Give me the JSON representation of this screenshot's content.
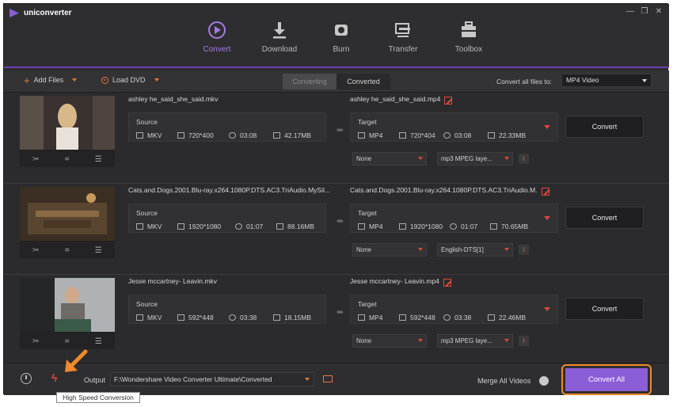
{
  "app": {
    "title": "uniconverter"
  },
  "window_controls": {
    "minimize": "—",
    "restore": "❐",
    "close": "✕"
  },
  "nav": [
    {
      "label": "Convert",
      "icon": "convert-icon",
      "active": true
    },
    {
      "label": "Download",
      "icon": "download-icon",
      "active": false
    },
    {
      "label": "Burn",
      "icon": "burn-icon",
      "active": false
    },
    {
      "label": "Transfer",
      "icon": "transfer-icon",
      "active": false
    },
    {
      "label": "Toolbox",
      "icon": "toolbox-icon",
      "active": false
    }
  ],
  "toolbar": {
    "add_files": "Add Files",
    "load_dvd": "Load DVD",
    "tab_converting": "Converting",
    "tab_converted": "Converted",
    "convert_all_to_label": "Convert all files to:",
    "convert_all_to_value": "MP4 Video"
  },
  "rows": [
    {
      "source_name": "ashley he_said_she_said.mkv",
      "source_label": "Source",
      "source": {
        "format": "MKV",
        "resolution": "720*400",
        "duration": "03:08",
        "size": "42.17MB"
      },
      "target_name": "ashley he_said_she_said.mp4",
      "target_label": "Target",
      "target": {
        "format": "MP4",
        "resolution": "720*404",
        "duration": "03:08",
        "size": "22.33MB"
      },
      "subtitle": "None",
      "audio": "mp3 MPEG laye...",
      "convert": "Convert"
    },
    {
      "source_name": "Cats.and.Dogs.2001.Blu-ray.x264.1080P.DTS.AC3.TriAudio.MySil...",
      "source_label": "Source",
      "source": {
        "format": "MKV",
        "resolution": "1920*1080",
        "duration": "01:07",
        "size": "88.16MB"
      },
      "target_name": "Cats.and.Dogs.2001.Blu-ray.x264.1080P.DTS.AC3.TriAudio.M...",
      "target_label": "Target",
      "target": {
        "format": "MP4",
        "resolution": "1920*1080",
        "duration": "01:07",
        "size": "70.65MB"
      },
      "subtitle": "None",
      "audio": "English-DTS[1]",
      "convert": "Convert"
    },
    {
      "source_name": "Jesse mccartney- Leavin.mkv",
      "source_label": "Source",
      "source": {
        "format": "MKV",
        "resolution": "592*448",
        "duration": "03:38",
        "size": "18.15MB"
      },
      "target_name": "Jesse mccartney- Leavin.mp4",
      "target_label": "Target",
      "target": {
        "format": "MP4",
        "resolution": "592*448",
        "duration": "03:38",
        "size": "22.46MB"
      },
      "subtitle": "None",
      "audio": "mp3 MPEG laye...",
      "convert": "Convert"
    }
  ],
  "footer": {
    "output_label": "Output",
    "output_path": "F:\\Wondershare Video Converter Ultimate\\Converted",
    "merge_label": "Merge All Videos",
    "merge_enabled": false,
    "convert_all": "Convert All",
    "tooltip": "High Speed Conversion"
  },
  "colors": {
    "accent": "#8b5dd6",
    "active_nav": "#a77ae3",
    "highlight": "#f08a2a",
    "warn": "#e0483c"
  }
}
